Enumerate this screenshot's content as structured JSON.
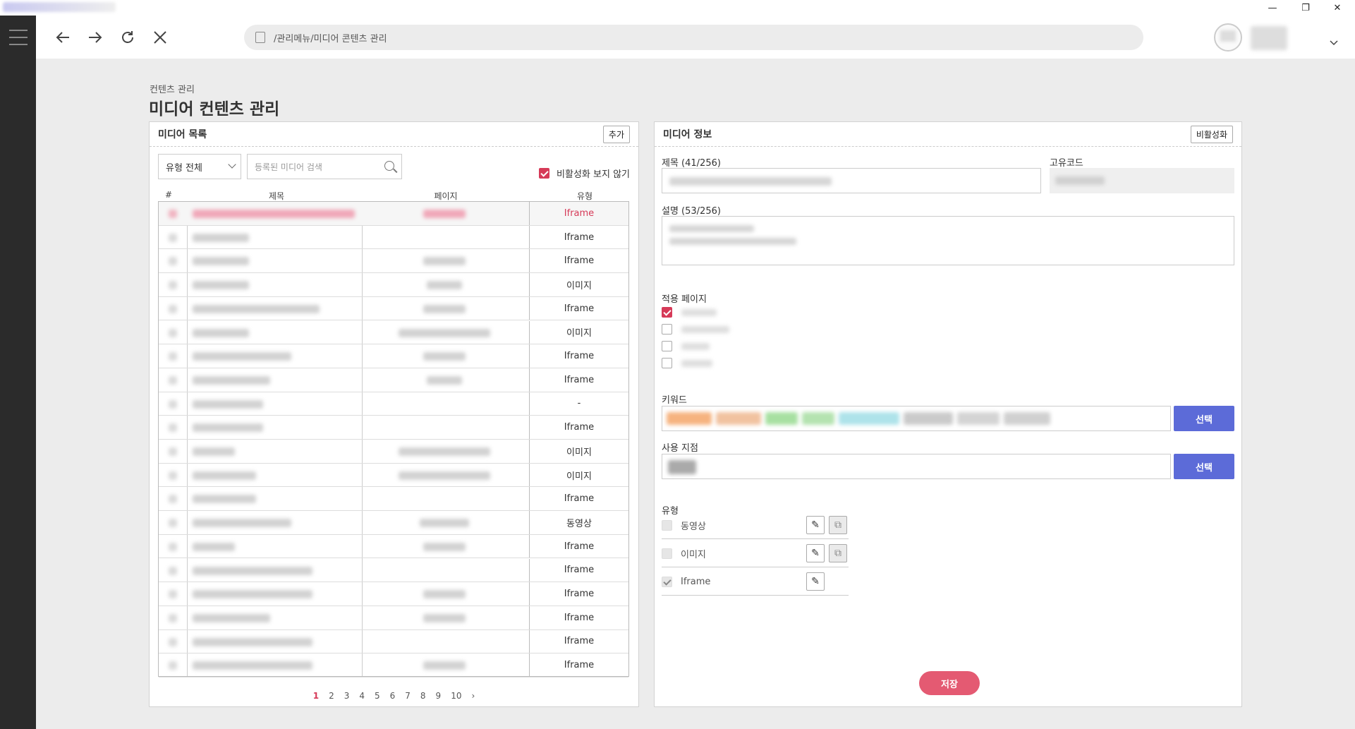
{
  "window": {
    "minimize": "—",
    "maximize": "❐",
    "close": "✕"
  },
  "address": "/관리메뉴/미디어 콘텐츠 관리",
  "breadcrumb": "컨텐츠 관리",
  "page_title": "미디어 컨텐츠 관리",
  "left": {
    "title": "미디어 목록",
    "add_label": "추가",
    "type_filter": "유형 전체",
    "search_placeholder": "등록된 미디어 검색",
    "hide_inactive_label": "비활성화 보지 않기",
    "columns": [
      "#",
      "제목",
      "페이지",
      "유형"
    ],
    "rows": [
      "Iframe",
      "Iframe",
      "Iframe",
      "이미지",
      "Iframe",
      "이미지",
      "Iframe",
      "Iframe",
      "-",
      "Iframe",
      "이미지",
      "이미지",
      "Iframe",
      "동영상",
      "Iframe",
      "Iframe",
      "Iframe",
      "Iframe",
      "Iframe",
      "Iframe"
    ],
    "pages": [
      "1",
      "2",
      "3",
      "4",
      "5",
      "6",
      "7",
      "8",
      "9",
      "10"
    ],
    "next": "›"
  },
  "right": {
    "title": "미디어 정보",
    "deactivate_label": "비활성화",
    "title_label": "제목 (41/256)",
    "code_label": "고유코드",
    "desc_label": "설명 (53/256)",
    "apply_pages_label": "적용 페이지",
    "keyword_label": "키워드",
    "keyword_select": "선택",
    "branch_label": "사용 지점",
    "branch_select": "선택",
    "type_label": "유형",
    "types": [
      "동영상",
      "이미지",
      "Iframe"
    ],
    "save_label": "저장",
    "colors": {
      "accent": "#d63a58",
      "select": "#5c6bd8",
      "save": "#e45a72"
    }
  }
}
